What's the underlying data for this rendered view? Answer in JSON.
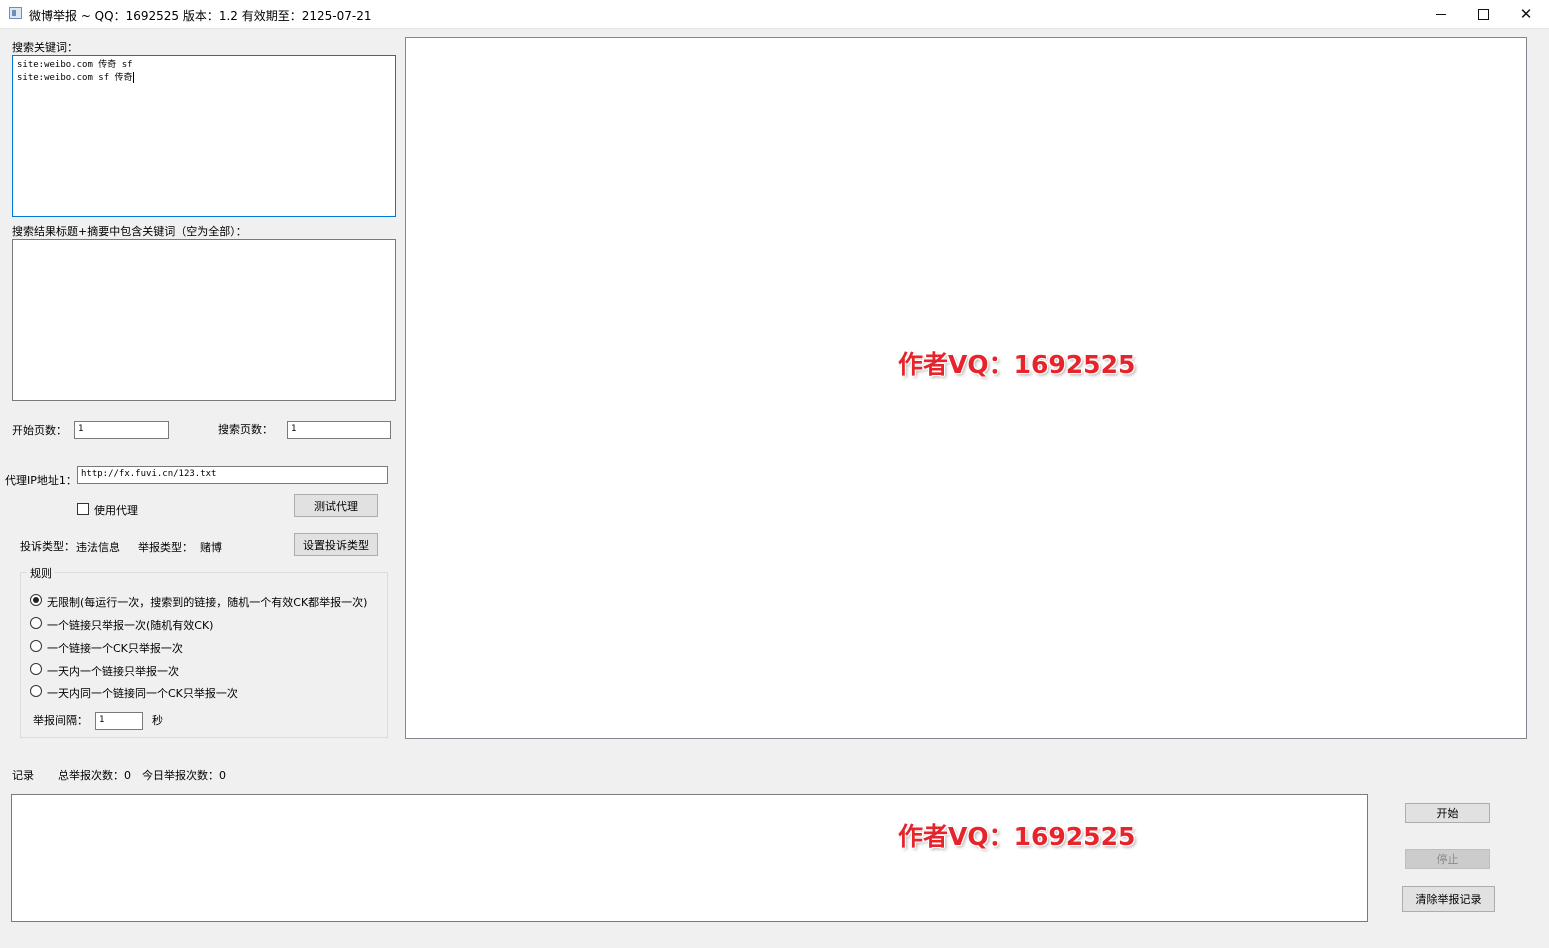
{
  "window": {
    "title": "微博举报 ~ QQ：1692525 版本：1.2 有效期至：2125-07-21",
    "minimize": "—",
    "maximize": "☐",
    "close": "✕"
  },
  "search": {
    "keywords_label": "搜索关键词：",
    "keywords_lines": [
      "site:weibo.com 传奇 sf",
      "site:weibo.com sf 传奇"
    ],
    "filter_label": "搜索结果标题+摘要中包含关键词（空为全部）：",
    "filter_value": "",
    "start_page_label": "开始页数：",
    "start_page_value": "1",
    "pages_label": "搜索页数：",
    "pages_value": "1"
  },
  "proxy": {
    "label": "代理IP地址1：",
    "value": "http://fx.fuvi.cn/123.txt",
    "use_proxy_label": "使用代理",
    "test_button": "测试代理"
  },
  "complaint": {
    "type_label": "投诉类型：",
    "type_value": "违法信息",
    "report_type_label": "举报类型：",
    "report_type_value": "赌博",
    "set_button": "设置投诉类型"
  },
  "rules": {
    "title": "规则",
    "options": [
      {
        "label": "无限制(每运行一次，搜索到的链接，随机一个有效CK都举报一次)",
        "selected": true
      },
      {
        "label": "一个链接只举报一次(随机有效CK)",
        "selected": false
      },
      {
        "label": "一个链接一个CK只举报一次",
        "selected": false
      },
      {
        "label": "一天内一个链接只举报一次",
        "selected": false
      },
      {
        "label": "一天内同一个链接同一个CK只举报一次",
        "selected": false
      }
    ],
    "interval_label": "举报间隔：",
    "interval_value": "1",
    "interval_unit": "秒"
  },
  "log": {
    "label": "记录",
    "total_label": "总举报次数：0",
    "today_label": "今日举报次数：0",
    "content": ""
  },
  "watermark": {
    "text": "作者VQ：1692525"
  },
  "actions": {
    "start": "开始",
    "stop": "停止",
    "clear": "清除举报记录"
  }
}
